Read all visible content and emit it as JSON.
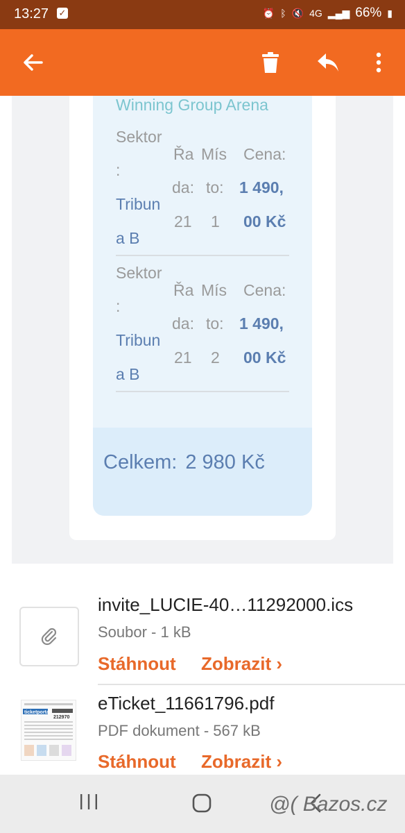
{
  "status": {
    "time": "13:27",
    "network": "4G",
    "battery": "66%",
    "colors": {
      "bar": "#8a3a12"
    }
  },
  "toolbar": {
    "color": "#f26a21",
    "icons": [
      "back-arrow-icon",
      "trash-icon",
      "reply-icon",
      "more-vert-icon"
    ]
  },
  "ticket": {
    "venue": "Winning Group Arena",
    "rows": [
      {
        "sector_label_1": "Sektor",
        "sector_label_2": ":",
        "sector_value_1": "Tribun",
        "sector_value_2": "a B",
        "row_label_1": "Řa",
        "row_label_2": "da:",
        "row_value": "21",
        "seat_label_1": "Mís",
        "seat_label_2": "to:",
        "seat_value": "1",
        "price_label": "Cena:",
        "price_value_1": "1 490,",
        "price_value_2": "00 Kč"
      },
      {
        "sector_label_1": "Sektor",
        "sector_label_2": ":",
        "sector_value_1": "Tribun",
        "sector_value_2": "a B",
        "row_label_1": "Řa",
        "row_label_2": "da:",
        "row_value": "21",
        "seat_label_1": "Mís",
        "seat_label_2": "to:",
        "seat_value": "2",
        "price_label": "Cena:",
        "price_value_1": "1 490,",
        "price_value_2": "00 Kč"
      }
    ],
    "total_label": "Celkem:",
    "total_value": "2 980 Kč"
  },
  "attachments": [
    {
      "name": "invite_LUCIE-40…11292000.ics",
      "meta": "Soubor - 1 kB",
      "download": "Stáhnout",
      "view": "Zobrazit ›",
      "icon": "paperclip-icon"
    },
    {
      "name": "eTicket_11661796.pdf",
      "meta": "PDF dokument - 567 kB",
      "download": "Stáhnout",
      "view": "Zobrazit ›",
      "thumb_brand": "ticketportal",
      "thumb_number": "212970"
    }
  ],
  "watermark": "@( Bazos.cz"
}
